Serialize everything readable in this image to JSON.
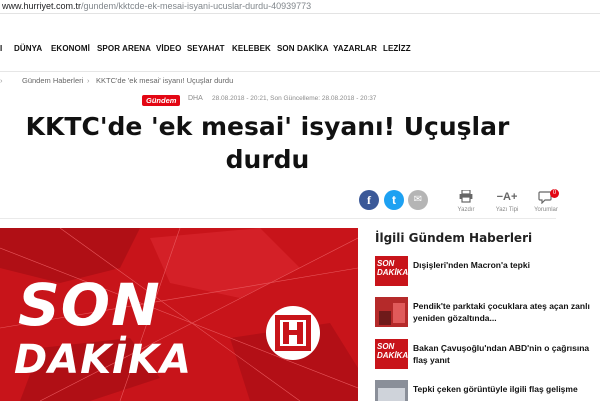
{
  "browser": {
    "url_host": "www.hurriyet.com.tr",
    "url_path": "/gundem/kktcde-ek-mesai-isyani-ucuslar-durdu-40939773"
  },
  "nav": {
    "items": [
      "DÜNYA",
      "EKONOMİ",
      "SPOR ARENA",
      "VİDEO",
      "SEYAHAT",
      "KELEBEK",
      "SON DAKİKA",
      "YAZARLAR",
      "LEZİZZ"
    ]
  },
  "breadcrumb": {
    "items": [
      "Gündem Haberleri",
      "KKTC'de 'ek mesai' isyanı! Uçuşlar durdu"
    ]
  },
  "article": {
    "category": "Gündem",
    "source": "DHA",
    "published": "28.08.2018 - 20:21, Son Güncelleme: 28.08.2018 - 20:37",
    "title_line1": "KKTC'de 'ek mesai' isyanı! Uçuşlar",
    "title_line2": "durdu"
  },
  "share": {
    "facebook_glyph": "f",
    "twitter_glyph": "t",
    "mail_glyph": "✉"
  },
  "tools": {
    "print_label": "Yazdır",
    "font_glyph": "−A+",
    "font_label": "Yazı Tipi",
    "comments_label": "Yorumlar",
    "comments_count": "0"
  },
  "hero": {
    "line1": "SON",
    "line2": "DAKİKA",
    "logo_letter": "H"
  },
  "related": {
    "title": "İlgili Gündem Haberleri",
    "items": [
      {
        "thumb": "SON DAKİKA",
        "text": "Dışişleri'nden Macron'a tepki"
      },
      {
        "thumb": "",
        "text": "Pendik'te parktaki çocuklara ateş açan zanlı yeniden gözaltında..."
      },
      {
        "thumb": "SON DAKİKA",
        "text": "Bakan Çavuşoğlu'ndan ABD'nin o çağrısına flaş yanıt"
      },
      {
        "thumb": "",
        "text": "Tepki çeken görüntüyle ilgili flaş gelişme"
      }
    ]
  },
  "colors": {
    "brand_red": "#e30613",
    "facebook": "#3b5998",
    "twitter": "#1da1f2",
    "mail": "#b5b5b5"
  }
}
